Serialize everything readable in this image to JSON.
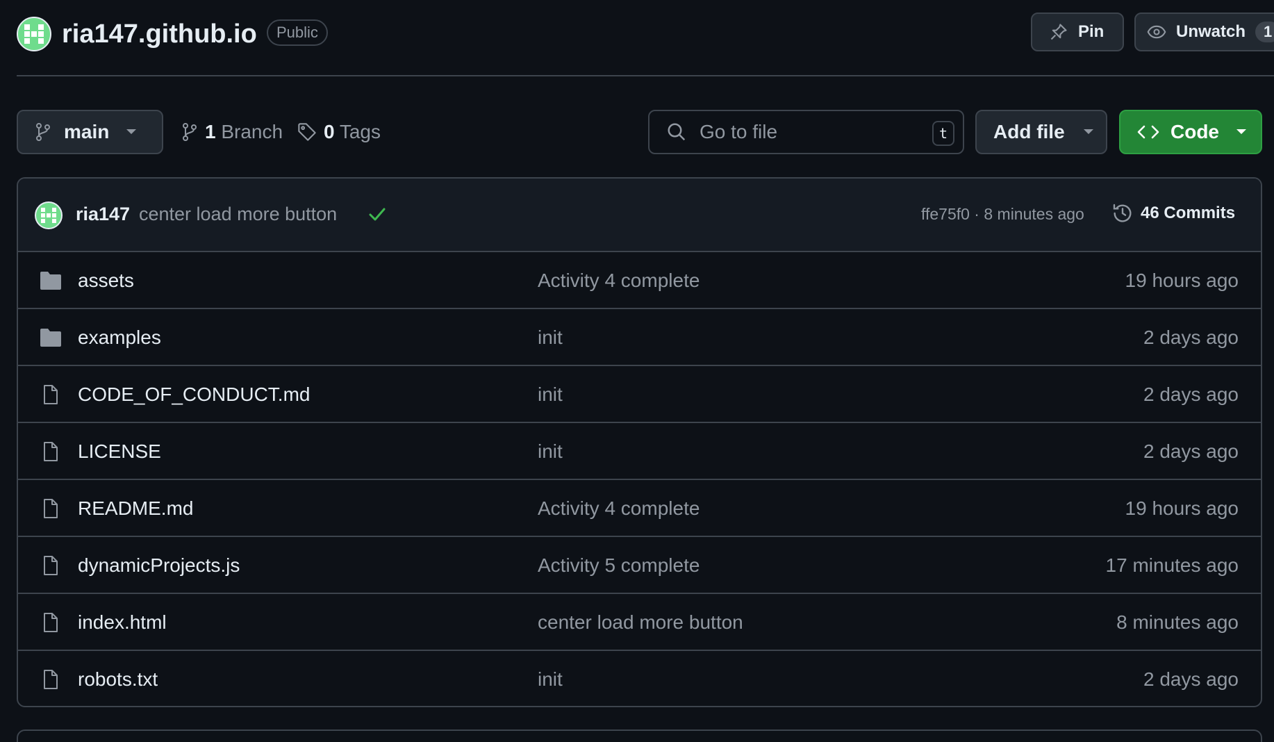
{
  "repo": {
    "name": "ria147.github.io",
    "visibility": "Public",
    "pin_label": "Pin",
    "unwatch_label": "Unwatch",
    "watch_count": "1"
  },
  "toolbar": {
    "branch": "main",
    "branch_count": "1",
    "branch_word": "Branch",
    "tag_count": "0",
    "tag_word": "Tags",
    "search_placeholder": "Go to file",
    "search_shortcut": "t",
    "add_file_label": "Add file",
    "code_label": "Code"
  },
  "latest_commit": {
    "author": "ria147",
    "message": "center load more button",
    "sha_and_time": "ffe75f0 · 8 minutes ago",
    "commit_count": "46 Commits"
  },
  "files": [
    {
      "type": "folder",
      "name": "assets",
      "message": "Activity 4 complete",
      "age": "19 hours ago"
    },
    {
      "type": "folder",
      "name": "examples",
      "message": "init",
      "age": "2 days ago"
    },
    {
      "type": "file",
      "name": "CODE_OF_CONDUCT.md",
      "message": "init",
      "age": "2 days ago"
    },
    {
      "type": "file",
      "name": "LICENSE",
      "message": "init",
      "age": "2 days ago"
    },
    {
      "type": "file",
      "name": "README.md",
      "message": "Activity 4 complete",
      "age": "19 hours ago"
    },
    {
      "type": "file",
      "name": "dynamicProjects.js",
      "message": "Activity 5 complete",
      "age": "17 minutes ago"
    },
    {
      "type": "file",
      "name": "index.html",
      "message": "center load more button",
      "age": "8 minutes ago"
    },
    {
      "type": "file",
      "name": "robots.txt",
      "message": "init",
      "age": "2 days ago"
    }
  ],
  "colors": {
    "background": "#0d1117",
    "border": "#3d444d",
    "muted_text": "#9198a1",
    "primary_green": "#238636",
    "check_green": "#3fb950",
    "avatar_green": "#6fdc8c"
  }
}
